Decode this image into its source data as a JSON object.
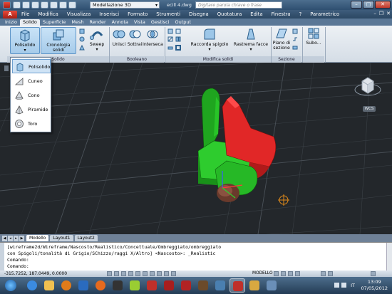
{
  "titlebar": {
    "workspace": "Modellazione 3D",
    "document": "ecill 4.dwg",
    "search_placeholder": "Digitare parola chiave o frase"
  },
  "menubar": {
    "items": [
      "File",
      "Modifica",
      "Visualizza",
      "Inserisci",
      "Formato",
      "Strumenti",
      "Disegna",
      "Quotatura",
      "Edita",
      "Finestra",
      "?",
      "Parametrico"
    ]
  },
  "ribbon": {
    "tabs": [
      "Inizio",
      "Solido",
      "Superficie",
      "Mesh",
      "Render",
      "Annota",
      "Vista",
      "Gestisci",
      "Output"
    ],
    "active_tab": "Solido",
    "buttons": {
      "polisolido": "Polisolido",
      "cronologia": "Cronologia solidi",
      "sweep": "Sweep",
      "unisci": "Unisci",
      "sottrai": "Sottrai",
      "interseca": "Interseca",
      "raccorda": "Raccorda spigolo",
      "rastrema": "Rastrema facce",
      "piano_l1": "Piano di",
      "piano_l2": "sezione",
      "subo": "Subo..."
    },
    "panels": {
      "solido": "Solido",
      "booleano": "Booleano",
      "modifica": "Modifica solidi",
      "sezione": "Sezione"
    }
  },
  "dropdown": {
    "items": [
      "Polisolido",
      "Cuneo",
      "Cono",
      "Piramide",
      "Toro"
    ],
    "highlighted": "Polisolido"
  },
  "viewcube": {
    "wcs": "WCS"
  },
  "layout_tabs": [
    "Modello",
    "Layout1",
    "Layout2"
  ],
  "command": {
    "lines": [
      "[wireframe2d/Wireframe/Nascosto/Realistico/Concettuale/Ombreggiato/ombreggiato",
      "con Spigoli/tonalità di Grigio/SChizzo/raggi X/Altro] <Nascosto>: _Realistic",
      "Comando:",
      "Comando:"
    ]
  },
  "status": {
    "coords": "-315.7252, 187.0449, 0.0000",
    "model": "MODELLO"
  },
  "taskbar": {
    "lang": "IT",
    "time": "13:09",
    "date": "07/05/2012"
  },
  "colors": {
    "green_part": "#22bb22",
    "red_part": "#dd2222",
    "viewport_bg": "#23272b"
  }
}
